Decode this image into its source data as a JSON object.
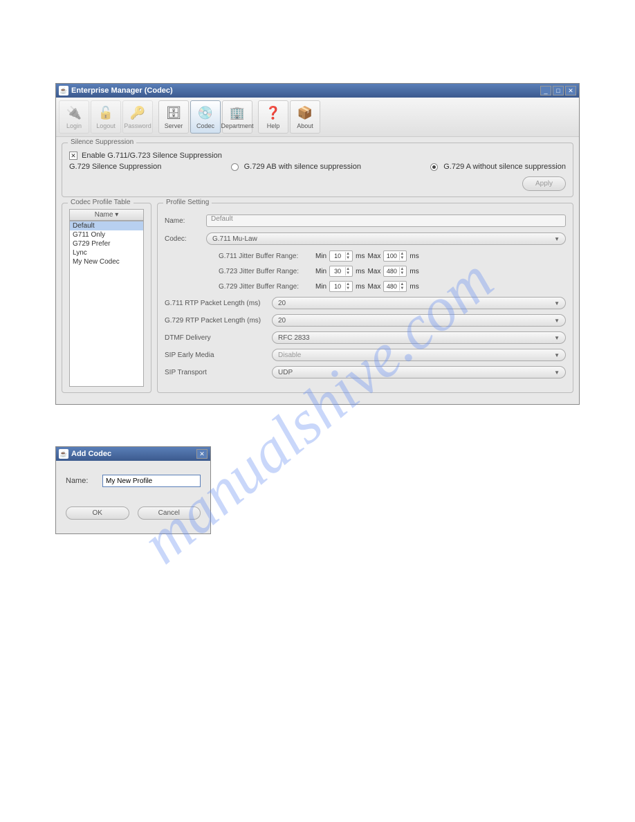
{
  "watermark": "manualshive.com",
  "main_window": {
    "title": "Enterprise Manager  (Codec)",
    "toolbar": {
      "login": "Login",
      "logout": "Logout",
      "password": "Password",
      "server": "Server",
      "codec": "Codec",
      "department": "Department",
      "help": "Help",
      "about": "About"
    },
    "silence": {
      "group_title": "Silence Suppression",
      "enable_label": "Enable G.711/G.723 Silence Suppression",
      "g729_label": "G.729 Silence Suppression",
      "radio_ab": "G.729 AB with silence suppression",
      "radio_a": "G.729 A without silence suppression",
      "apply": "Apply"
    },
    "codec_table": {
      "group_title": "Codec Profile Table",
      "header": "Name ▾",
      "items": [
        "Default",
        "G711 Only",
        "G729 Prefer",
        "Lync",
        "My New Codec"
      ]
    },
    "profile": {
      "group_title": "Profile Setting",
      "name_label": "Name:",
      "name_value": "Default",
      "codec_label": "Codec:",
      "codec_value": "G.711 Mu-Law",
      "jitter": {
        "g711": "G.711 Jitter Buffer Range:",
        "g723": "G.723 Jitter Buffer Range:",
        "g729": "G.729 Jitter Buffer Range:",
        "min_label": "Min",
        "max_label": "Max",
        "ms": "ms",
        "g711_min": "10",
        "g711_max": "100",
        "g723_min": "30",
        "g723_max": "480",
        "g729_min": "10",
        "g729_max": "480"
      },
      "settings": {
        "g711_rtp": {
          "label": "G.711 RTP Packet Length (ms)",
          "value": "20"
        },
        "g729_rtp": {
          "label": "G.729 RTP Packet Length (ms)",
          "value": "20"
        },
        "dtmf": {
          "label": "DTMF Delivery",
          "value": "RFC 2833"
        },
        "sip_early": {
          "label": "SIP Early Media",
          "value": "Disable"
        },
        "sip_transport": {
          "label": "SIP Transport",
          "value": "UDP"
        }
      }
    }
  },
  "dialog": {
    "title": "Add Codec",
    "name_label": "Name:",
    "name_value": "My New Profile",
    "ok": "OK",
    "cancel": "Cancel"
  }
}
